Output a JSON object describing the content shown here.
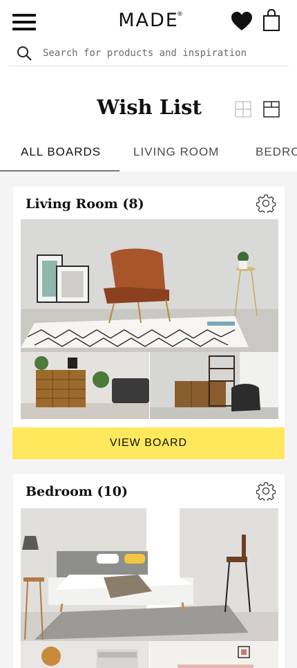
{
  "header": {
    "logo": "MADE",
    "logo_mark": "®",
    "icons": [
      "menu-icon",
      "heart-icon",
      "bag-icon",
      "search-icon",
      "grid-view-icon",
      "single-view-icon"
    ],
    "search": {
      "placeholder": "Search for products and inspiration"
    }
  },
  "page_title": "Wish List",
  "tabs": [
    {
      "label": "ALL BOARDS",
      "active": true
    },
    {
      "label": "LIVING ROOM",
      "active": false
    },
    {
      "label": "BEDRO",
      "active": false
    }
  ],
  "boards": [
    {
      "name": "Living Room (8)",
      "button": "VIEW BOARD"
    },
    {
      "name": "Bedroom (10)"
    }
  ],
  "colors": {
    "accent_button": "#ffe85c",
    "background": "#f4f4f4"
  }
}
